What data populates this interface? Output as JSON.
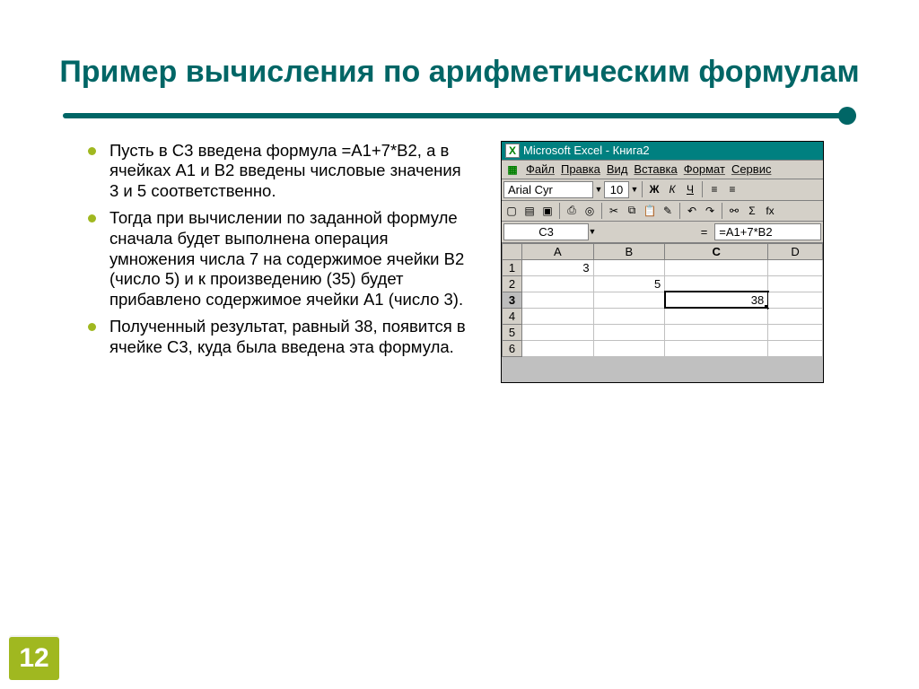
{
  "title": "Пример вычисления по арифметическим формулам",
  "bullets": [
    "Пусть в C3 введена формула =А1+7*В2, а в ячейках А1 и В2 введены числовые значения 3 и 5 соответственно.",
    "Тогда при вычислении по заданной формуле сначала будет выполнена операция умножения числа 7 на содержимое ячейки В2 (число 5) и к произведению (35) будет прибавлено содержимое ячейки А1 (число 3).",
    "Полученный результат, равный 38, появится в ячейке С3, куда была введена эта формула."
  ],
  "excel": {
    "title_app": "Microsoft Excel - Книга2",
    "menubar": [
      "Файл",
      "Правка",
      "Вид",
      "Вставка",
      "Формат",
      "Сервис"
    ],
    "font_name": "Arial Cyr",
    "font_size": "10",
    "fmt": {
      "b": "Ж",
      "i": "К",
      "u": "Ч"
    },
    "name_box": "C3",
    "formula": "=A1+7*B2",
    "columns": [
      "A",
      "B",
      "C",
      "D"
    ],
    "rows": [
      "1",
      "2",
      "3",
      "4",
      "5",
      "6"
    ],
    "cells": {
      "r1": {
        "A": "3",
        "B": "",
        "C": "",
        "D": ""
      },
      "r2": {
        "A": "",
        "B": "5",
        "C": "",
        "D": ""
      },
      "r3": {
        "A": "",
        "B": "",
        "C": "38",
        "D": ""
      },
      "r4": {
        "A": "",
        "B": "",
        "C": "",
        "D": ""
      },
      "r5": {
        "A": "",
        "B": "",
        "C": "",
        "D": ""
      },
      "r6": {
        "A": "",
        "B": "",
        "C": "",
        "D": ""
      }
    },
    "sel_col": "C",
    "sel_row": "3"
  },
  "page_number": "12",
  "chart_data": {
    "type": "table",
    "title": "Spreadsheet cell values",
    "columns": [
      "A",
      "B",
      "C",
      "D"
    ],
    "rows": [
      {
        "row": 1,
        "A": 3,
        "B": null,
        "C": null,
        "D": null
      },
      {
        "row": 2,
        "A": null,
        "B": 5,
        "C": null,
        "D": null
      },
      {
        "row": 3,
        "A": null,
        "B": null,
        "C": 38,
        "D": null
      }
    ],
    "formula_cell": "C3",
    "formula": "=A1+7*B2"
  }
}
